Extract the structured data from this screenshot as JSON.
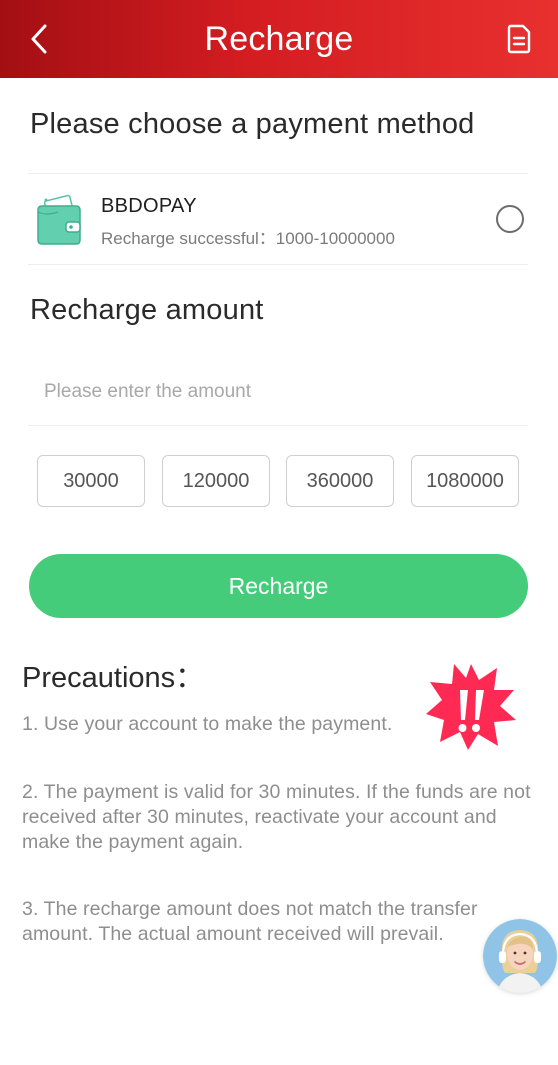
{
  "header": {
    "title": "Recharge",
    "back_icon": "chevron-left-icon",
    "record_icon": "document-icon",
    "gradient": [
      "#a30f14",
      "#e8302f"
    ]
  },
  "payment": {
    "section_title": "Please choose a payment method",
    "options": [
      {
        "name": "BBDOPAY",
        "description": "Recharge successful：1000-10000000",
        "icon": "wallet-icon",
        "selected": false
      }
    ]
  },
  "amount": {
    "section_title": "Recharge amount",
    "input_placeholder": "Please enter the amount",
    "input_value": "",
    "presets": [
      "30000",
      "120000",
      "360000",
      "1080000"
    ]
  },
  "recharge_button": {
    "label": "Recharge",
    "color": "#44cc7b"
  },
  "precautions": {
    "title": "Precautions：",
    "icon": "alert-icon",
    "items": [
      "1. Use your account to make the payment.",
      "2. The payment is valid for 30 minutes. If the funds are not received after 30 minutes, reactivate your account and make the payment again.",
      "3. The recharge amount does not match the transfer amount. The actual amount received will prevail."
    ]
  },
  "support": {
    "icon": "customer-service-avatar-icon"
  }
}
